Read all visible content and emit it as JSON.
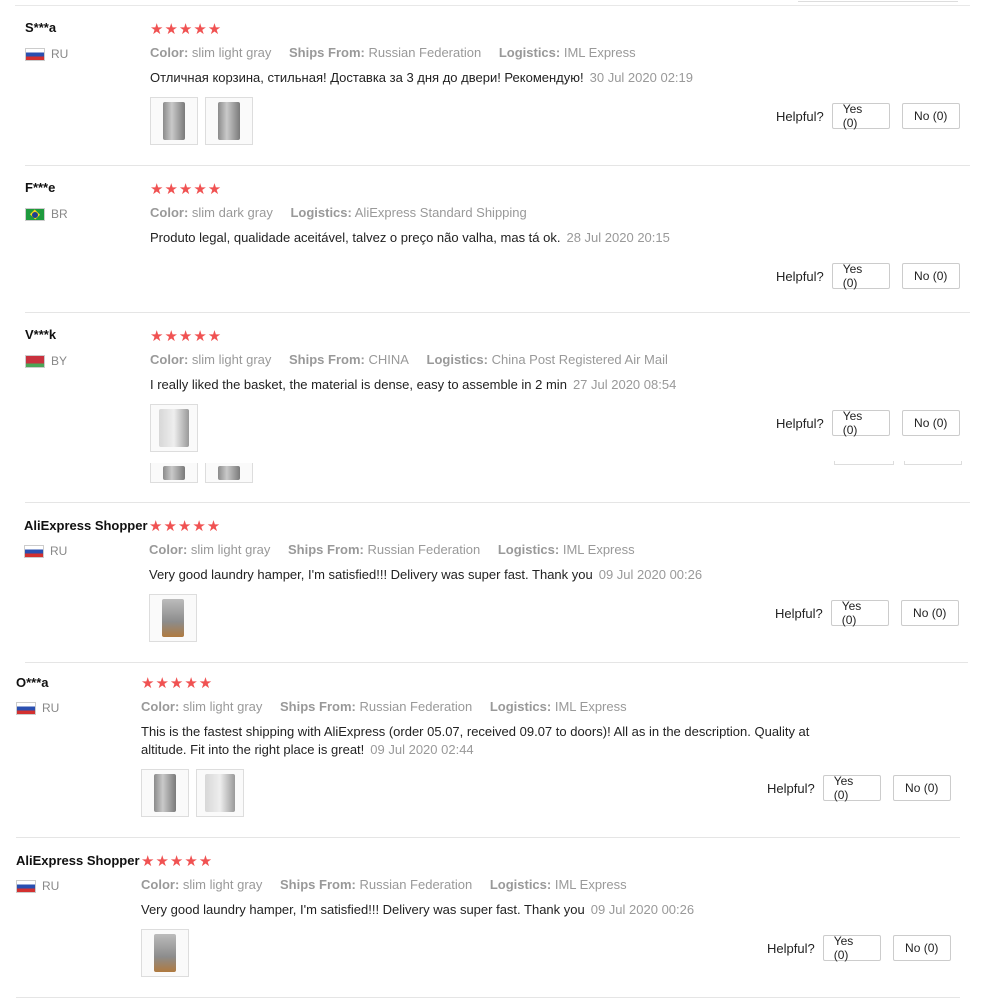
{
  "labels": {
    "color": "Color:",
    "ships_from": "Ships From:",
    "logistics": "Logistics:",
    "helpful": "Helpful?"
  },
  "reviews": [
    {
      "name": "S***a",
      "country": "RU",
      "stars": "★★★★★",
      "color": "slim light gray",
      "ships_from": "Russian Federation",
      "logistics": "IML Express",
      "text": "Отличная корзина, стильная! Доставка за 3 дня до двери! Рекомендую!",
      "date": "30 Jul 2020 02:19",
      "yes": "Yes (0)",
      "no": "No (0)"
    },
    {
      "name": "F***e",
      "country": "BR",
      "stars": "★★★★★",
      "color": "slim dark gray",
      "logistics": "AliExpress Standard Shipping",
      "text": "Produto legal, qualidade aceitável, talvez o preço não valha, mas tá ok.",
      "date": "28 Jul 2020 20:15",
      "yes": "Yes (0)",
      "no": "No (0)"
    },
    {
      "name": "V***k",
      "country": "BY",
      "stars": "★★★★★",
      "color": "slim light gray",
      "ships_from": "CHINA",
      "logistics": "China Post Registered Air Mail",
      "text": "I really liked the basket, the material is dense, easy to assemble in 2 min",
      "date": "27 Jul 2020 08:54",
      "yes": "Yes (0)",
      "no": "No (0)"
    },
    {
      "name": "AliExpress Shopper",
      "country": "RU",
      "stars": "★★★★★",
      "color": "slim light gray",
      "ships_from": "Russian Federation",
      "logistics": "IML Express",
      "text": "Very good laundry hamper, I'm satisfied!!! Delivery was super fast. Thank you",
      "date": "09 Jul 2020 00:26",
      "yes": "Yes (0)",
      "no": "No (0)"
    },
    {
      "name": "O***a",
      "country": "RU",
      "stars": "★★★★★",
      "color": "slim light gray",
      "ships_from": "Russian Federation",
      "logistics": "IML Express",
      "text": "This is the fastest shipping with AliExpress (order 05.07, received 09.07 to doors)! All as in the description. Quality at altitude. Fit into the right place is great!",
      "date": "09 Jul 2020 02:44",
      "yes": "Yes (0)",
      "no": "No (0)"
    },
    {
      "name": "AliExpress Shopper",
      "country": "RU",
      "stars": "★★★★★",
      "color": "slim light gray",
      "ships_from": "Russian Federation",
      "logistics": "IML Express",
      "text": "Very good laundry hamper, I'm satisfied!!! Delivery was super fast. Thank you",
      "date": "09 Jul 2020 00:26",
      "yes": "Yes (0)",
      "no": "No (0)"
    }
  ]
}
